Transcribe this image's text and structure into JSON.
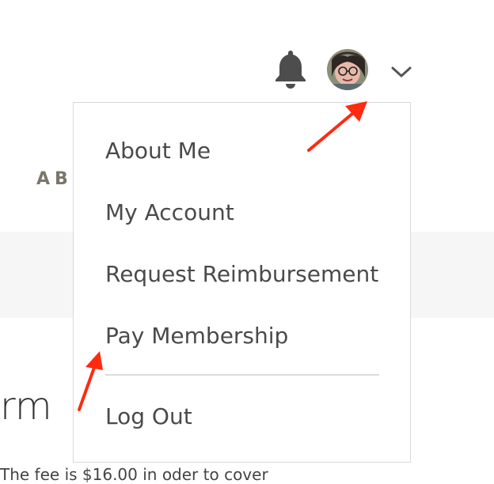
{
  "page": {
    "heading_partial": "AB",
    "form_title_partial": "rm",
    "note_partial": "The fee is $16.00 in oder to cover"
  },
  "header": {
    "bell_icon": "bell-icon",
    "avatar_icon": "user-avatar",
    "chevron_icon": "chevron-down-icon"
  },
  "menu": {
    "items": [
      {
        "label": "About Me"
      },
      {
        "label": "My Account"
      },
      {
        "label": "Request Reimbursement"
      },
      {
        "label": "Pay Membership"
      },
      {
        "label": "Log Out"
      }
    ]
  },
  "annotations": {
    "arrow_color": "#ff2a10"
  }
}
